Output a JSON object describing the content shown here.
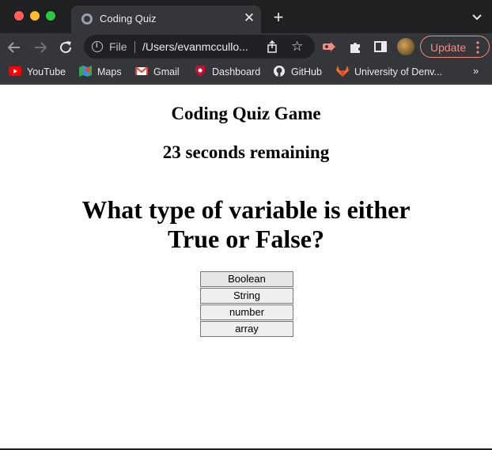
{
  "browser": {
    "tab": {
      "title": "Coding Quiz",
      "close_glyph": "✕"
    },
    "new_tab_glyph": "+",
    "omnibox": {
      "scheme_label": "File",
      "url": "/Users/evanmccullo..."
    },
    "update_label": "Update",
    "update_color": "#f28b82",
    "bookmarks": [
      {
        "label": "YouTube",
        "icon": "youtube-icon"
      },
      {
        "label": "Maps",
        "icon": "maps-icon"
      },
      {
        "label": "Gmail",
        "icon": "gmail-icon"
      },
      {
        "label": "Dashboard",
        "icon": "dashboard-icon"
      },
      {
        "label": "GitHub",
        "icon": "github-icon"
      },
      {
        "label": "University of Denv...",
        "icon": "gitlab-icon"
      }
    ],
    "bookmarks_overflow_glyph": "»"
  },
  "quiz": {
    "title": "Coding Quiz Game",
    "timer_text": "23 seconds remaining",
    "question": "What type of variable is either True or False?",
    "answers": [
      "Boolean",
      "String",
      "number",
      "array"
    ]
  }
}
